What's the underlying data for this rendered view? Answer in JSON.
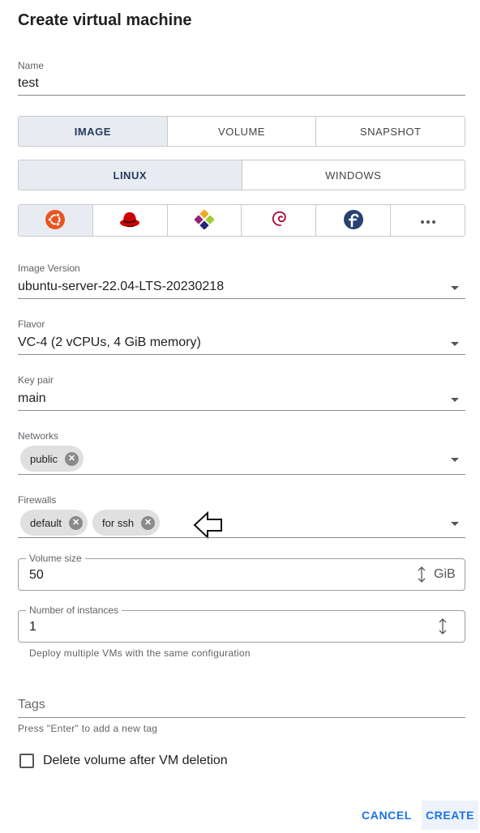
{
  "dialog": {
    "title": "Create virtual machine"
  },
  "name": {
    "label": "Name",
    "value": "test"
  },
  "source_tabs": [
    {
      "label": "IMAGE",
      "active": true
    },
    {
      "label": "VOLUME",
      "active": false
    },
    {
      "label": "SNAPSHOT",
      "active": false
    }
  ],
  "os_tabs": [
    {
      "label": "LINUX",
      "active": true
    },
    {
      "label": "WINDOWS",
      "active": false
    }
  ],
  "distros": [
    {
      "icon": "ubuntu-icon",
      "active": true,
      "color": "#e95420"
    },
    {
      "icon": "redhat-icon",
      "active": false,
      "color": "#cc0000"
    },
    {
      "icon": "centos-icon",
      "active": false,
      "color": "#932279"
    },
    {
      "icon": "debian-icon",
      "active": false,
      "color": "#a80030"
    },
    {
      "icon": "fedora-icon",
      "active": false,
      "color": "#294172"
    },
    {
      "icon": "more-icon",
      "active": false,
      "color": "#555555"
    }
  ],
  "image_version": {
    "label": "Image Version",
    "value": "ubuntu-server-22.04-LTS-20230218"
  },
  "flavor": {
    "label": "Flavor",
    "value": "VC-4 (2 vCPUs, 4 GiB memory)"
  },
  "key_pair": {
    "label": "Key pair",
    "value": "main"
  },
  "networks": {
    "label": "Networks",
    "chips": [
      "public"
    ]
  },
  "firewalls": {
    "label": "Firewalls",
    "chips": [
      "default",
      "for ssh"
    ]
  },
  "volume_size": {
    "label": "Volume size",
    "value": "50",
    "unit": "GiB"
  },
  "instances": {
    "label": "Number of instances",
    "value": "1",
    "hint": "Deploy multiple VMs with the same configuration"
  },
  "tags": {
    "placeholder": "Tags",
    "hint": "Press \"Enter\" to add a new tag"
  },
  "delete_volume": {
    "label": "Delete volume after VM deletion",
    "checked": false
  },
  "actions": {
    "cancel": "CANCEL",
    "create": "CREATE"
  },
  "colors": {
    "accent": "#1a73e8",
    "active_tab_bg": "#e8ecf2"
  }
}
